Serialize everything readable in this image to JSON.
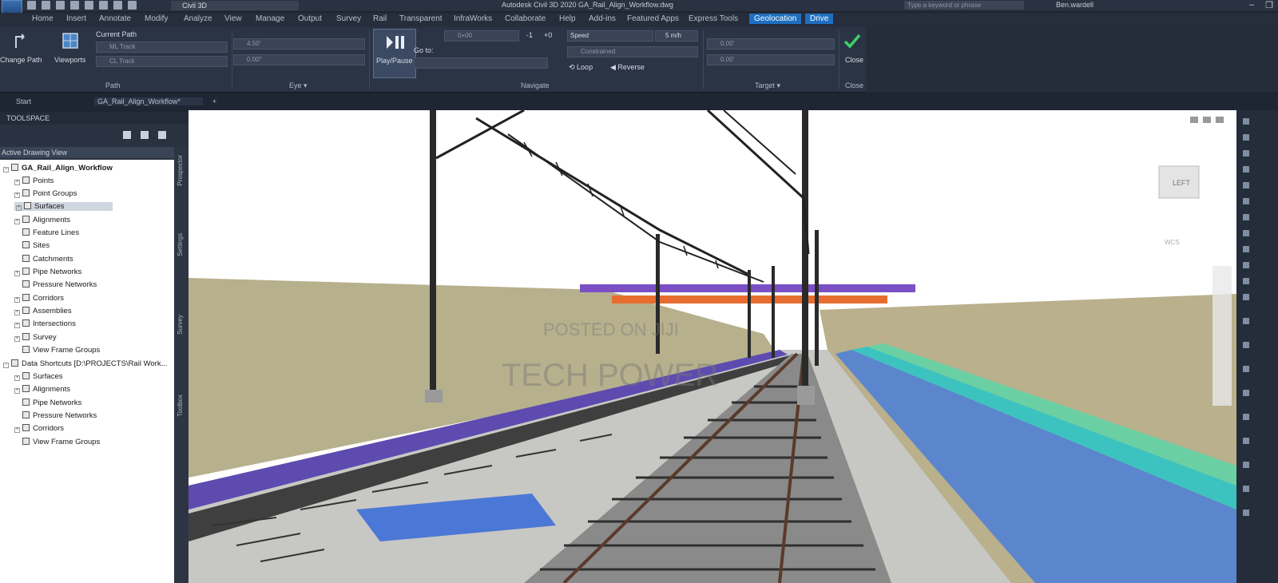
{
  "titlebar": {
    "workspace": "Civil 3D",
    "document_title": "Autodesk Civil 3D 2020   GA_Rail_Align_Workflow.dwg",
    "search_placeholder": "Type a keyword or phrase",
    "user": "Ben.wardell"
  },
  "menu": {
    "tabs": [
      "Home",
      "Insert",
      "Annotate",
      "Modify",
      "Analyze",
      "View",
      "Manage",
      "Output",
      "Survey",
      "Rail",
      "Transparent",
      "InfraWorks",
      "Collaborate",
      "Help",
      "Add-ins",
      "Featured Apps",
      "Express Tools",
      "Geolocation",
      "Drive"
    ],
    "active_tab": "Geolocation"
  },
  "ribbon": {
    "change_path": "Change Path",
    "viewports": "Viewports",
    "current_path": "Current Path",
    "path_input_1": "ML Track",
    "path_input_2": "CL Track",
    "group_path": "Path",
    "eye_input_1": "4.50'",
    "eye_input_2": "0.00°",
    "group_eye": "Eye ▾",
    "play_pause": "Play/Pause",
    "station_input": "0+00",
    "go_to": "Go to:",
    "step_minus": "-1",
    "step_plus": "+0",
    "group_navigate": "Navigate",
    "speed_label": "Speed",
    "speed_value": "5 m/h",
    "speed_combo": "Constrained",
    "loop": "Loop",
    "reverse": "Reverse",
    "target_input_1": "0.00'",
    "target_input_2": "0.00'",
    "group_target": "Target ▾",
    "close": "Close",
    "group_close": "Close"
  },
  "doctabs": {
    "start": "Start",
    "drawing": "GA_Rail_Align_Workflow*",
    "add": "+"
  },
  "toolspace": {
    "title": "TOOLSPACE",
    "view_combo": "Active Drawing View",
    "root": "GA_Rail_Align_Workflow",
    "items": [
      "Points",
      "Point Groups",
      "Surfaces",
      "Alignments",
      "Feature Lines",
      "Sites",
      "Catchments",
      "Pipe Networks",
      "Pressure Networks",
      "Corridors",
      "Assemblies",
      "Intersections",
      "Survey",
      "View Frame Groups"
    ],
    "shortcuts_root": "Data Shortcuts [D:\\PROJECTS\\Rail Work...",
    "shortcut_items": [
      "Surfaces",
      "Alignments",
      "Pipe Networks",
      "Pressure Networks",
      "Corridors",
      "View Frame Groups"
    ],
    "side_tabs": [
      "Prospector",
      "Settings",
      "Survey",
      "Toolbox"
    ]
  },
  "viewport": {
    "watermark_1": "POSTED ON JIJI",
    "watermark_2": "TECH POWER",
    "viewcube_label": "LEFT",
    "viewcube_compass": "WCS"
  }
}
